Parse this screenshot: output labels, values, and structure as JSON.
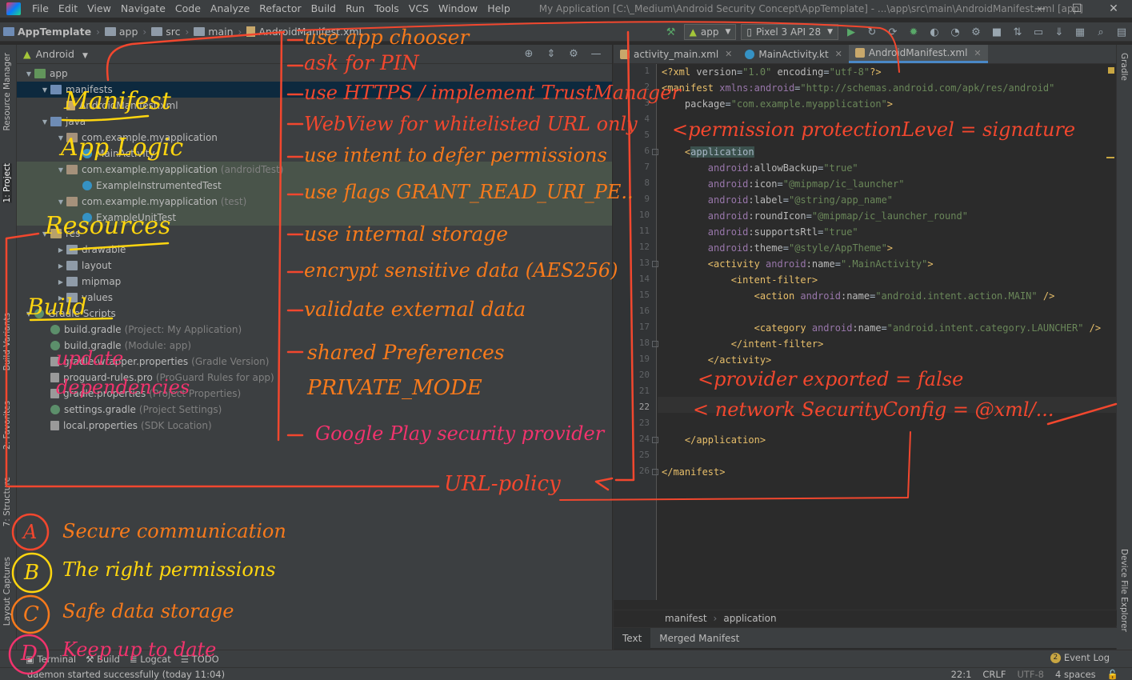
{
  "menubar": {
    "items": [
      "File",
      "Edit",
      "View",
      "Navigate",
      "Code",
      "Analyze",
      "Refactor",
      "Build",
      "Run",
      "Tools",
      "VCS",
      "Window",
      "Help"
    ],
    "window_title": "My Application [C:\\_Medium\\Android Security Concept\\AppTemplate] - ...\\app\\src\\main\\AndroidManifest.xml [app]",
    "controls": [
      "—",
      "☐",
      "✕"
    ]
  },
  "navbar": {
    "crumbs": [
      "AppTemplate",
      "app",
      "src",
      "main",
      "AndroidManifest.xml"
    ],
    "run_config": "app",
    "device": "Pixel 3 API 28"
  },
  "left_strip": {
    "tabs": [
      "Resource Manager",
      "1: Project",
      "Build Variants",
      "2: Favorites",
      "7: Structure",
      "Layout Captures"
    ]
  },
  "right_strip": {
    "tabs": [
      "Gradle",
      "Device File Explorer"
    ]
  },
  "project_panel": {
    "view_mode": "Android",
    "tree": [
      {
        "label": "app",
        "muted": "",
        "indent": 0,
        "icon": "folder-green",
        "twisty": "▼"
      },
      {
        "label": "manifests",
        "muted": "",
        "indent": 1,
        "icon": "folder-blue",
        "twisty": "▼",
        "selected": true
      },
      {
        "label": "AndroidManifest.xml",
        "muted": "",
        "indent": 2,
        "icon": "xmlf",
        "twisty": ""
      },
      {
        "label": "java",
        "muted": "",
        "indent": 1,
        "icon": "folder-blue",
        "twisty": "▼"
      },
      {
        "label": "com.example.myapplication",
        "muted": "",
        "indent": 2,
        "icon": "pkg",
        "twisty": "▼"
      },
      {
        "label": "MainActivity",
        "muted": "",
        "indent": 3,
        "icon": "class",
        "twisty": ""
      },
      {
        "label": "com.example.myapplication",
        "muted": "(androidTest)",
        "indent": 2,
        "icon": "pkg",
        "twisty": "▼",
        "test": true
      },
      {
        "label": "ExampleInstrumentedTest",
        "muted": "",
        "indent": 3,
        "icon": "class",
        "twisty": "",
        "test": true
      },
      {
        "label": "com.example.myapplication",
        "muted": "(test)",
        "indent": 2,
        "icon": "pkg",
        "twisty": "▼",
        "test": true
      },
      {
        "label": "ExampleUnitTest",
        "muted": "",
        "indent": 3,
        "icon": "class",
        "twisty": "",
        "test": true
      },
      {
        "label": "res",
        "muted": "",
        "indent": 1,
        "icon": "folder-res",
        "twisty": "▼"
      },
      {
        "label": "drawable",
        "muted": "",
        "indent": 2,
        "icon": "folder",
        "twisty": "▶"
      },
      {
        "label": "layout",
        "muted": "",
        "indent": 2,
        "icon": "folder",
        "twisty": "▶"
      },
      {
        "label": "mipmap",
        "muted": "",
        "indent": 2,
        "icon": "folder",
        "twisty": "▶"
      },
      {
        "label": "values",
        "muted": "",
        "indent": 2,
        "icon": "folder",
        "twisty": "▶"
      },
      {
        "label": "Gradle Scripts",
        "muted": "",
        "indent": 0,
        "icon": "gradle",
        "twisty": "▼"
      },
      {
        "label": "build.gradle",
        "muted": "(Project: My Application)",
        "indent": 1,
        "icon": "gradle",
        "twisty": ""
      },
      {
        "label": "build.gradle",
        "muted": "(Module: app)",
        "indent": 1,
        "icon": "gradle",
        "twisty": ""
      },
      {
        "label": "gradle-wrapper.properties",
        "muted": "(Gradle Version)",
        "indent": 1,
        "icon": "file",
        "twisty": ""
      },
      {
        "label": "proguard-rules.pro",
        "muted": "(ProGuard Rules for app)",
        "indent": 1,
        "icon": "file",
        "twisty": ""
      },
      {
        "label": "gradle.properties",
        "muted": "(Project Properties)",
        "indent": 1,
        "icon": "file",
        "twisty": ""
      },
      {
        "label": "settings.gradle",
        "muted": "(Project Settings)",
        "indent": 1,
        "icon": "gradle",
        "twisty": ""
      },
      {
        "label": "local.properties",
        "muted": "(SDK Location)",
        "indent": 1,
        "icon": "file",
        "twisty": ""
      }
    ]
  },
  "editor": {
    "tabs": [
      {
        "label": "activity_main.xml",
        "icon": "xml",
        "active": false
      },
      {
        "label": "MainActivity.kt",
        "icon": "kt",
        "active": false
      },
      {
        "label": "AndroidManifest.xml",
        "icon": "xml",
        "active": true
      }
    ],
    "line_numbers": [
      "1",
      "2",
      "3",
      "4",
      "5",
      "6",
      "7",
      "8",
      "9",
      "10",
      "11",
      "12",
      "13",
      "14",
      "15",
      "16",
      "17",
      "18",
      "19",
      "20",
      "21",
      "22",
      "23",
      "24",
      "25",
      "26"
    ],
    "current_line": "22",
    "code": [
      {
        "n": 1,
        "parts": [
          [
            "tag",
            "<?xml "
          ],
          [
            "attr",
            "version"
          ],
          [
            "",
            "="
          ],
          [
            "str",
            "\"1.0\""
          ],
          [
            "attr",
            " encoding"
          ],
          [
            "",
            "="
          ],
          [
            "str",
            "\"utf-8\""
          ],
          [
            "tag",
            "?>"
          ]
        ]
      },
      {
        "n": 2,
        "parts": [
          [
            "tag",
            "<manifest "
          ],
          [
            "ns",
            "xmlns:android"
          ],
          [
            "",
            "="
          ],
          [
            "str",
            "\"http://schemas.android.com/apk/res/android\""
          ]
        ]
      },
      {
        "n": 3,
        "parts": [
          [
            "",
            "    "
          ],
          [
            "attr",
            "package"
          ],
          [
            "",
            "="
          ],
          [
            "str",
            "\"com.example.myapplication\""
          ],
          [
            "tag",
            ">"
          ]
        ]
      },
      {
        "n": 6,
        "parts": [
          [
            "",
            "    "
          ],
          [
            "tag",
            "<"
          ],
          [
            "hl",
            "application"
          ]
        ]
      },
      {
        "n": 7,
        "parts": [
          [
            "",
            "        "
          ],
          [
            "ns",
            "android"
          ],
          [
            "attr",
            ":allowBackup"
          ],
          [
            "",
            "="
          ],
          [
            "str",
            "\"true\""
          ]
        ]
      },
      {
        "n": 8,
        "parts": [
          [
            "",
            "        "
          ],
          [
            "ns",
            "android"
          ],
          [
            "attr",
            ":icon"
          ],
          [
            "",
            "="
          ],
          [
            "str",
            "\"@mipmap/ic_launcher\""
          ]
        ]
      },
      {
        "n": 9,
        "parts": [
          [
            "",
            "        "
          ],
          [
            "ns",
            "android"
          ],
          [
            "attr",
            ":label"
          ],
          [
            "",
            "="
          ],
          [
            "str",
            "\"@string/app_name\""
          ]
        ]
      },
      {
        "n": 10,
        "parts": [
          [
            "",
            "        "
          ],
          [
            "ns",
            "android"
          ],
          [
            "attr",
            ":roundIcon"
          ],
          [
            "",
            "="
          ],
          [
            "str",
            "\"@mipmap/ic_launcher_round\""
          ]
        ]
      },
      {
        "n": 11,
        "parts": [
          [
            "",
            "        "
          ],
          [
            "ns",
            "android"
          ],
          [
            "attr",
            ":supportsRtl"
          ],
          [
            "",
            "="
          ],
          [
            "str",
            "\"true\""
          ]
        ]
      },
      {
        "n": 12,
        "parts": [
          [
            "",
            "        "
          ],
          [
            "ns",
            "android"
          ],
          [
            "attr",
            ":theme"
          ],
          [
            "",
            "="
          ],
          [
            "str",
            "\"@style/AppTheme\""
          ],
          [
            "tag",
            ">"
          ]
        ]
      },
      {
        "n": 13,
        "parts": [
          [
            "",
            "        "
          ],
          [
            "tag",
            "<activity "
          ],
          [
            "ns",
            "android"
          ],
          [
            "attr",
            ":name"
          ],
          [
            "",
            "="
          ],
          [
            "str",
            "\".MainActivity\""
          ],
          [
            "tag",
            ">"
          ]
        ]
      },
      {
        "n": 14,
        "parts": [
          [
            "",
            "            "
          ],
          [
            "tag",
            "<intent-filter>"
          ]
        ]
      },
      {
        "n": 15,
        "parts": [
          [
            "",
            "                "
          ],
          [
            "tag",
            "<action "
          ],
          [
            "ns",
            "android"
          ],
          [
            "attr",
            ":name"
          ],
          [
            "",
            "="
          ],
          [
            "str",
            "\"android.intent.action.MAIN\""
          ],
          [
            "tag",
            " />"
          ]
        ]
      },
      {
        "n": 17,
        "parts": [
          [
            "",
            "                "
          ],
          [
            "tag",
            "<category "
          ],
          [
            "ns",
            "android"
          ],
          [
            "attr",
            ":name"
          ],
          [
            "",
            "="
          ],
          [
            "str",
            "\"android.intent.category.LAUNCHER\""
          ],
          [
            "tag",
            " />"
          ]
        ]
      },
      {
        "n": 18,
        "parts": [
          [
            "",
            "            "
          ],
          [
            "tag",
            "</intent-filter>"
          ]
        ]
      },
      {
        "n": 19,
        "parts": [
          [
            "",
            "        "
          ],
          [
            "tag",
            "</activity>"
          ]
        ]
      },
      {
        "n": 24,
        "parts": [
          [
            "",
            "    "
          ],
          [
            "tag",
            "</application>"
          ]
        ]
      },
      {
        "n": 26,
        "parts": [
          [
            "tag",
            "</manifest>"
          ]
        ]
      }
    ],
    "breadcrumb": [
      "manifest",
      "application"
    ],
    "bottom_tabs": [
      "Text",
      "Merged Manifest"
    ]
  },
  "toolwindows": {
    "tabs": [
      "Terminal",
      "Build",
      "Logcat",
      "TODO"
    ],
    "event_log_count": "2",
    "event_log_label": "Event Log"
  },
  "statusbar": {
    "message": "daemon started successfully (today 11:04)",
    "position": "22:1",
    "line_sep": "CRLF",
    "encoding": "UTF-8",
    "indent": "4 spaces"
  },
  "annotations": {
    "security_list": [
      "use app chooser",
      "ask for PIN",
      "use HTTPS / implement TrustManager",
      "WebView for whitelisted URL only",
      "use intent to defer permissions",
      "use flags GRANT_READ_URI_PE..",
      "use internal storage",
      "encrypt sensitive data (AES256)",
      "validate external data",
      "shared Preferences",
      "PRIVATE_MODE",
      "Google Play security provider"
    ],
    "section_labels": [
      "Manifest",
      "App Logic",
      "Resources",
      "Build",
      "update dependencies"
    ],
    "manifest_notes": [
      "<permission protectionLevel = signature",
      "<provider exported = false",
      "< network SecurityConfig = @xml/..."
    ],
    "url_policy": "URL-policy",
    "legend": [
      {
        "letter": "A",
        "text": "Secure communication"
      },
      {
        "letter": "B",
        "text": "The right permissions"
      },
      {
        "letter": "C",
        "text": "Safe data storage"
      },
      {
        "letter": "D",
        "text": "Keep up to date"
      }
    ],
    "colors": {
      "red": "#f2472e",
      "orange": "#f77a1c",
      "yellow": "#ffd60f",
      "pink": "#f1336d"
    }
  }
}
